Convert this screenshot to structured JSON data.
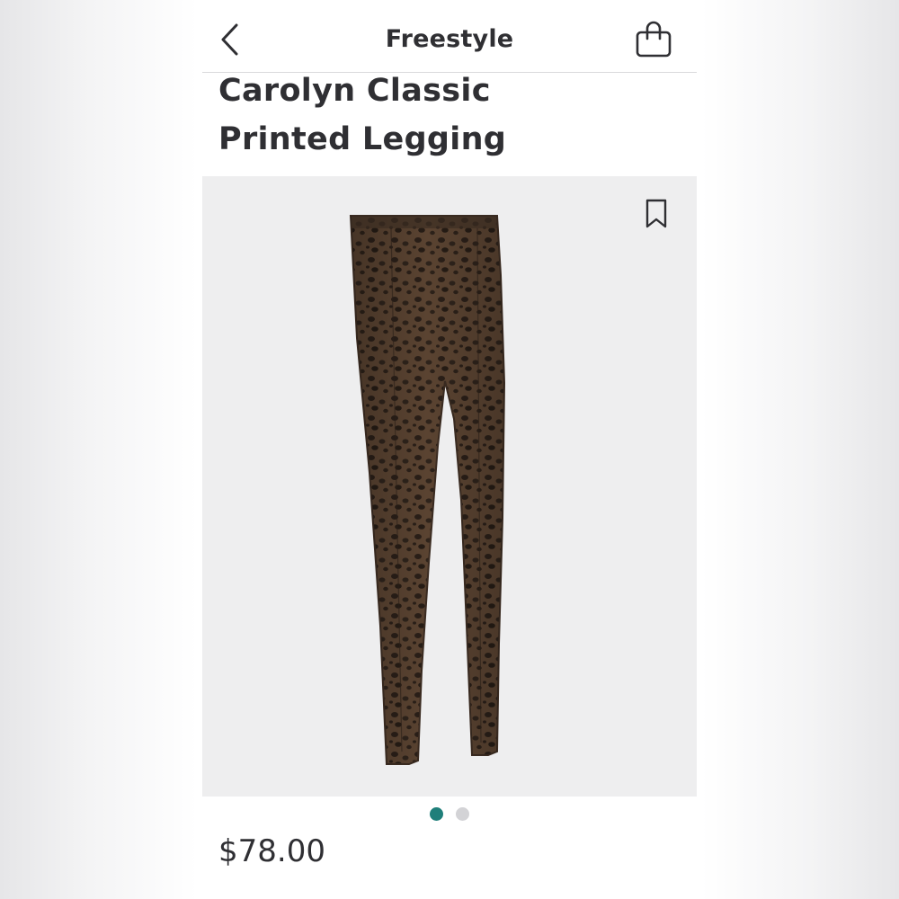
{
  "nav": {
    "title": "Freestyle",
    "back_icon": "chevron-left-icon",
    "bag_icon": "shopping-bag-icon"
  },
  "product": {
    "name_line1": "Carolyn Classic",
    "name_line2": "Printed Legging",
    "price": "$78.00",
    "save_icon": "bookmark-icon"
  },
  "carousel": {
    "page_count": 2,
    "active_index": 0,
    "active_color": "#1f7f7a",
    "inactive_color": "#d3d3d6"
  },
  "colors": {
    "text": "#2f2f33",
    "image_bg": "#eeeeef",
    "fabric": "#4a382c"
  }
}
